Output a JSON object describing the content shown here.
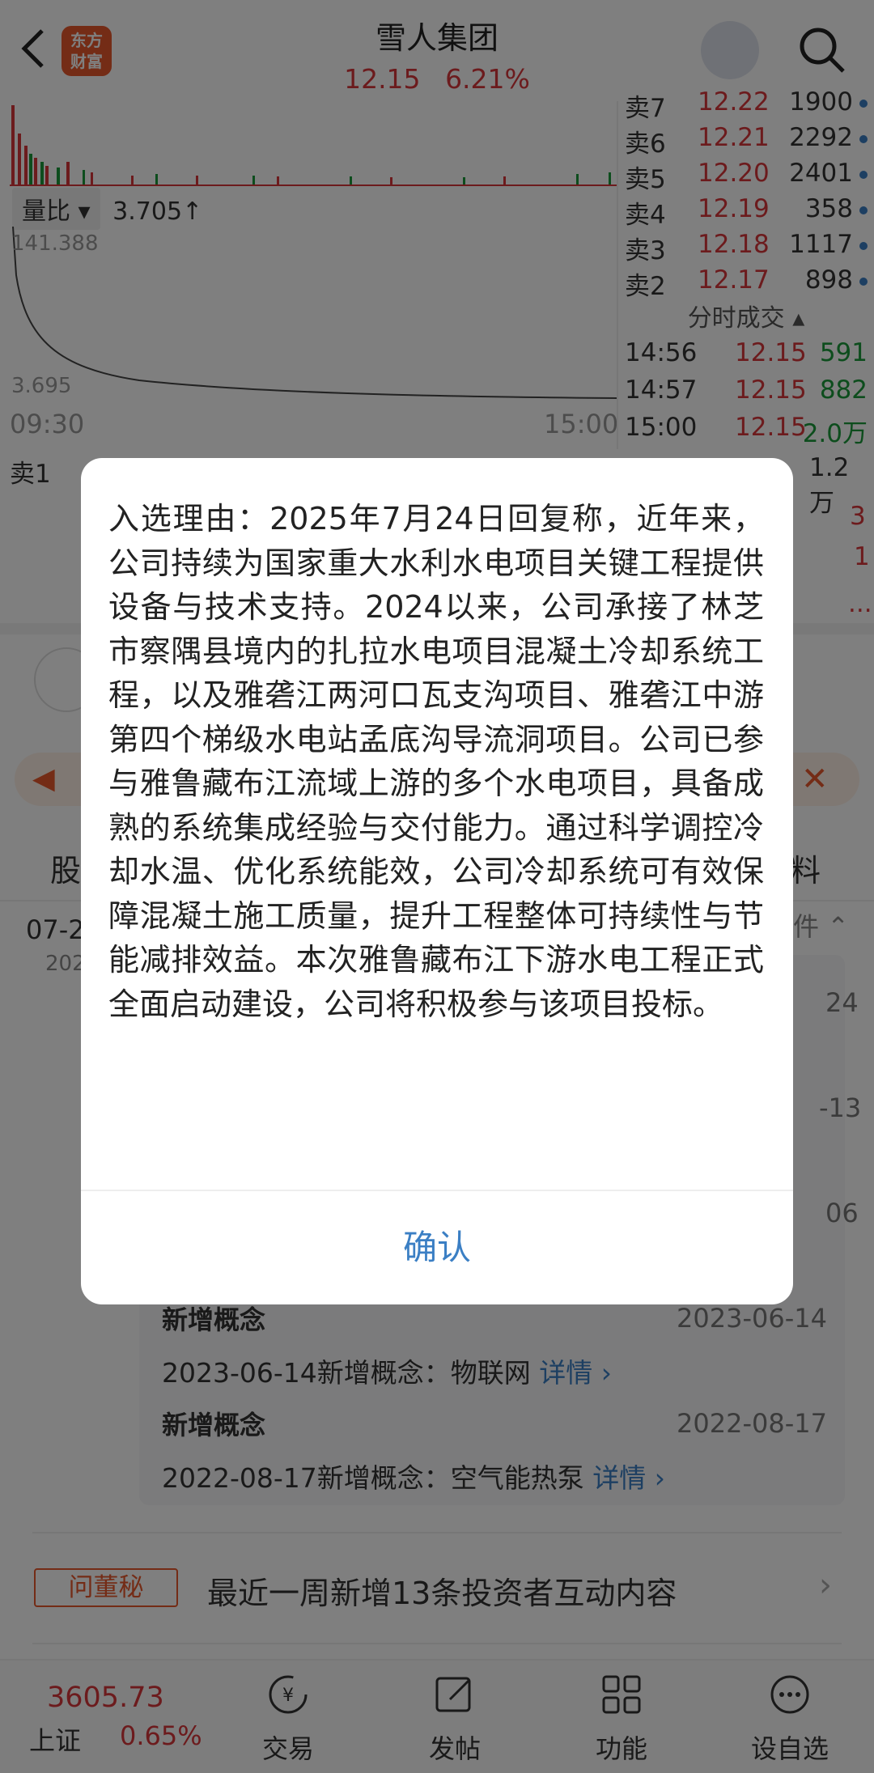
{
  "header": {
    "title": "雪人集团",
    "price": "12.15",
    "change_pct": "6.21%",
    "logo_text": "东方财富"
  },
  "chart": {
    "volume_ratio_label": "量比",
    "volume_ratio_value": "3.705↑",
    "ratio_axis_top": "141.388",
    "ratio_axis_bottom": "3.695",
    "time_start": "09:30",
    "time_end": "15:00"
  },
  "order_book": [
    {
      "label": "卖7",
      "price": "12.22",
      "volume": "1900"
    },
    {
      "label": "卖6",
      "price": "12.21",
      "volume": "2292"
    },
    {
      "label": "卖5",
      "price": "12.20",
      "volume": "2401"
    },
    {
      "label": "卖4",
      "price": "12.19",
      "volume": "358"
    },
    {
      "label": "卖3",
      "price": "12.18",
      "volume": "1117"
    },
    {
      "label": "卖2",
      "price": "12.17",
      "volume": "898"
    }
  ],
  "ticks_title": "分时成交",
  "ticks": [
    {
      "time": "14:56",
      "price": "12.15",
      "volume": "591"
    },
    {
      "time": "14:57",
      "price": "12.15",
      "volume": "882"
    },
    {
      "time": "15:00",
      "price": "12.15",
      "volume": "2.0万"
    }
  ],
  "sell1": {
    "label": "卖1",
    "volume": "1.2万"
  },
  "right_partial": [
    "3",
    "1",
    "..."
  ],
  "tabs": {
    "left_partial": "股",
    "right_partial": "料"
  },
  "news_date": {
    "short": "07-2",
    "year": "202"
  },
  "filter_partial": "件",
  "card": {
    "partial_dates": [
      "24",
      "-13",
      "06"
    ],
    "items": [
      {
        "title": "新增概念",
        "date": "2023-06-14",
        "text": "2023-06-14新增概念：物联网",
        "link": "详情"
      },
      {
        "title": "新增概念",
        "date": "2022-08-17",
        "text": "2022-08-17新增概念：空气能热泵",
        "link": "详情"
      }
    ]
  },
  "wdm": {
    "badge": "问董秘",
    "text": "最近一周新增13条投资者互动内容"
  },
  "bottom": {
    "index_value": "3605.73",
    "index_name": "上证",
    "index_pct": "0.65%",
    "nav": [
      {
        "label": "交易",
        "icon": "trade-icon"
      },
      {
        "label": "发帖",
        "icon": "post-icon"
      },
      {
        "label": "功能",
        "icon": "function-icon"
      },
      {
        "label": "设自选",
        "icon": "favorite-icon"
      }
    ]
  },
  "dialog": {
    "text": "入选理由：2025年7月24日回复称，近年来，公司持续为国家重大水利水电项目关键工程提供设备与技术支持。2024以来，公司承接了林芝市察隅县境内的扎拉水电项目混凝土冷却系统工程，以及雅砻江两河口瓦支沟项目、雅砻江中游第四个梯级水电站孟底沟导流洞项目。公司已参与雅鲁藏布江流域上游的多个水电项目，具备成熟的系统集成经验与交付能力。通过科学调控冷却水温、优化系统能效，公司冷却系统可有效保障混凝土施工质量，提升工程整体可持续性与节能减排效益。本次雅鲁藏布江下游水电工程正式全面启动建设，公司将积极参与该项目投标。",
    "confirm": "确认"
  },
  "colors": {
    "up": "#d9373b",
    "down": "#1a9a3a",
    "link": "#3b7fc4",
    "brand": "#e8582c"
  }
}
